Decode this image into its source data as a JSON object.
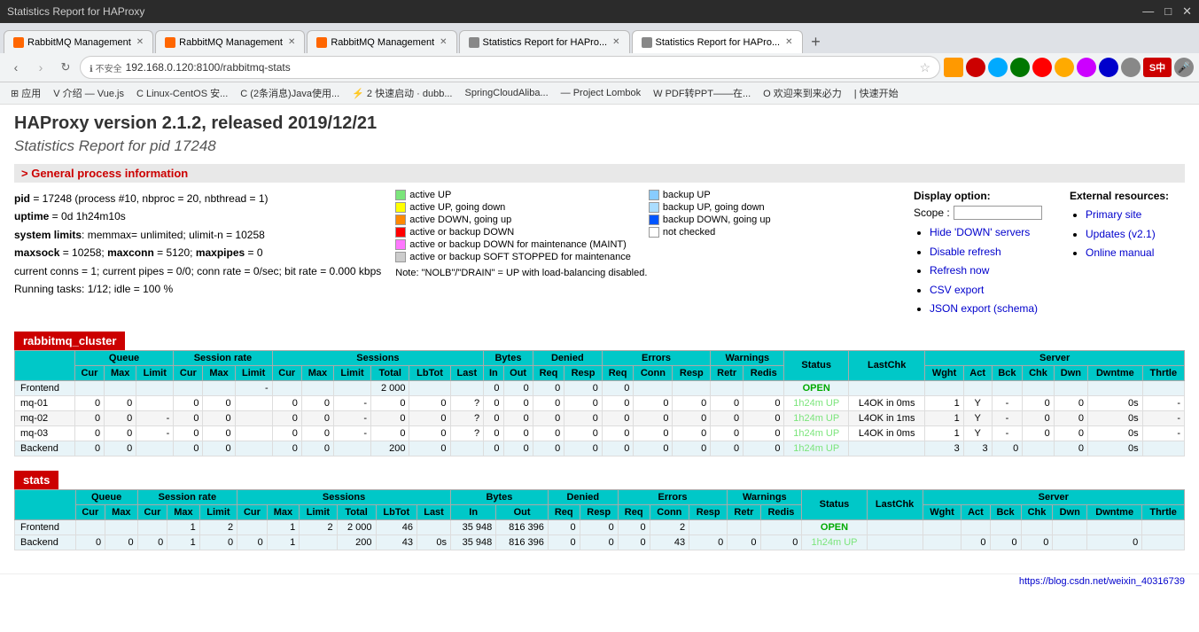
{
  "browser": {
    "tabs": [
      {
        "label": "RabbitMQ Management",
        "active": false,
        "favicon": "rabbit"
      },
      {
        "label": "RabbitMQ Management",
        "active": false,
        "favicon": "rabbit"
      },
      {
        "label": "RabbitMQ Management",
        "active": false,
        "favicon": "rabbit"
      },
      {
        "label": "Statistics Report for HAPro...",
        "active": false,
        "favicon": "stats"
      },
      {
        "label": "Statistics Report for HAPro...",
        "active": true,
        "favicon": "stats"
      }
    ],
    "address": "192.168.0.120:8100/rabbitmq-stats",
    "bookmarks": [
      "应用",
      "介绍 — Vue.js",
      "Linux-CentOS 安...",
      "(2条消息)Java使用...",
      "2 快速启动 · dubb...",
      "SpringCloudAliba...",
      "Project Lombok",
      "PDF转PPT——在...",
      "欢迎来到来必力",
      "快速开始"
    ],
    "title_bar_controls": [
      "—",
      "□",
      "×"
    ]
  },
  "page": {
    "version_title": "HAProxy version 2.1.2, released 2019/12/21",
    "stats_title": "Statistics Report for pid 17248",
    "section_general": "> General process information",
    "process_info": [
      "pid = 17248 (process #10, nbproc = 20, nbthread = 1)",
      "uptime = 0d 1h24m10s",
      "system limits: memmax= unlimited; ulimit-n = 10258",
      "maxsock = 10258; maxconn = 5120; maxpipes = 0",
      "current conns = 1; current pipes = 0/0; conn rate = 0/sec; bit rate = 0.000 kbps",
      "Running tasks: 1/12; idle = 100 %"
    ]
  },
  "legend": {
    "items_left": [
      {
        "color": "#00ff00",
        "label": "active UP"
      },
      {
        "color": "#ffff00",
        "label": "active UP, going down"
      },
      {
        "color": "#ff8800",
        "label": "active DOWN, going up"
      },
      {
        "color": "#ff0000",
        "label": "active or backup DOWN"
      },
      {
        "color": "#ff00ff",
        "label": "active or backup DOWN for maintenance (MAINT)"
      },
      {
        "color": "#aaaaaa",
        "label": "active or backup SOFT STOPPED for maintenance"
      }
    ],
    "items_right": [
      {
        "color": "#00aaff",
        "label": "backup UP"
      },
      {
        "color": "#88ccff",
        "label": "backup UP, going down"
      },
      {
        "color": "#0055ff",
        "label": "backup DOWN, going up"
      },
      {
        "color": "#ffffff",
        "label": "not checked"
      }
    ],
    "note": "Note: \"NOLB\"/\"DRAIN\" = UP with load-balancing disabled."
  },
  "display_options": {
    "title": "Display option:",
    "scope_label": "Scope :",
    "scope_value": "",
    "links": [
      {
        "label": "Hide 'DOWN' servers",
        "href": "#"
      },
      {
        "label": "Disable refresh",
        "href": "#"
      },
      {
        "label": "Refresh now",
        "href": "#"
      },
      {
        "label": "CSV export",
        "href": "#"
      },
      {
        "label": "JSON export",
        "href": "#"
      },
      {
        "label": "(schema)",
        "href": "#"
      }
    ]
  },
  "external_resources": {
    "title": "External resources:",
    "links": [
      {
        "label": "Primary site",
        "href": "#"
      },
      {
        "label": "Updates (v2.1)",
        "href": "#"
      },
      {
        "label": "Online manual",
        "href": "#"
      }
    ]
  },
  "sections": [
    {
      "name": "rabbitmq_cluster",
      "color": "#c00",
      "headers": {
        "queue": [
          "Cur",
          "Max",
          "Limit"
        ],
        "session_rate": [
          "Cur",
          "Max",
          "Limit"
        ],
        "sessions": [
          "Cur",
          "Max",
          "Limit",
          "Total",
          "LbTot",
          "Last"
        ],
        "bytes": [
          "In",
          "Out"
        ],
        "denied": [
          "Req",
          "Resp"
        ],
        "errors": [
          "Req",
          "Conn",
          "Resp"
        ],
        "warnings": [
          "Retr",
          "Redis"
        ],
        "status": "Status",
        "lastchk": "LastChk",
        "server": [
          "Wght",
          "Act",
          "Bck",
          "Chk",
          "Dwn",
          "Dwntme",
          "Thrtle"
        ]
      },
      "rows": [
        {
          "name": "Frontend",
          "type": "frontend",
          "queue": [
            "",
            "",
            ""
          ],
          "session_rate": [
            "",
            "",
            "-"
          ],
          "sessions": [
            "",
            "",
            "",
            "2 000",
            "",
            ""
          ],
          "bytes": [
            "0",
            "0"
          ],
          "denied": [
            "0",
            "0"
          ],
          "errors": [
            "0",
            "",
            ""
          ],
          "warnings": [
            "",
            ""
          ],
          "status": "OPEN",
          "lastchk": "",
          "server": [
            "",
            "",
            "",
            "",
            "",
            "",
            ""
          ]
        },
        {
          "name": "mq-01",
          "type": "server",
          "queue": [
            "0",
            "0",
            ""
          ],
          "session_rate": [
            "0",
            "0",
            ""
          ],
          "sessions": [
            "0",
            "0",
            "-",
            "0",
            "0",
            "?"
          ],
          "bytes": [
            "0",
            "0"
          ],
          "denied": [
            "0",
            "0"
          ],
          "errors": [
            "0",
            "0",
            "0"
          ],
          "warnings": [
            "0",
            "0"
          ],
          "status": "1h24m UP",
          "lastchk": "L4OK in 0ms",
          "server": [
            "1",
            "Y",
            "-",
            "0",
            "0",
            "0s",
            "-"
          ]
        },
        {
          "name": "mq-02",
          "type": "server",
          "queue": [
            "0",
            "0",
            "-"
          ],
          "session_rate": [
            "0",
            "0",
            ""
          ],
          "sessions": [
            "0",
            "0",
            "-",
            "0",
            "0",
            "?"
          ],
          "bytes": [
            "0",
            "0"
          ],
          "denied": [
            "0",
            "0"
          ],
          "errors": [
            "0",
            "0",
            "0"
          ],
          "warnings": [
            "0",
            "0"
          ],
          "status": "1h24m UP",
          "lastchk": "L4OK in 1ms",
          "server": [
            "1",
            "Y",
            "-",
            "0",
            "0",
            "0s",
            "-"
          ]
        },
        {
          "name": "mq-03",
          "type": "server",
          "queue": [
            "0",
            "0",
            "-"
          ],
          "session_rate": [
            "0",
            "0",
            ""
          ],
          "sessions": [
            "0",
            "0",
            "-",
            "0",
            "0",
            "?"
          ],
          "bytes": [
            "0",
            "0"
          ],
          "denied": [
            "0",
            "0"
          ],
          "errors": [
            "0",
            "0",
            "0"
          ],
          "warnings": [
            "0",
            "0"
          ],
          "status": "1h24m UP",
          "lastchk": "L4OK in 0ms",
          "server": [
            "1",
            "Y",
            "-",
            "0",
            "0",
            "0s",
            "-"
          ]
        },
        {
          "name": "Backend",
          "type": "backend",
          "queue": [
            "0",
            "0",
            ""
          ],
          "session_rate": [
            "0",
            "0",
            ""
          ],
          "sessions": [
            "0",
            "0",
            "",
            "200",
            "0",
            ""
          ],
          "bytes": [
            "0",
            "0"
          ],
          "denied": [
            "0",
            "0"
          ],
          "errors": [
            "0",
            "0",
            "0"
          ],
          "warnings": [
            "0",
            "0"
          ],
          "status": "1h24m UP",
          "lastchk": "",
          "server": [
            "3",
            "3",
            "0",
            "",
            "0",
            "0s",
            ""
          ]
        }
      ]
    },
    {
      "name": "stats",
      "color": "#c00",
      "rows": [
        {
          "name": "Frontend",
          "type": "frontend",
          "queue": [
            "",
            ""
          ],
          "session_rate": [
            "",
            "1",
            "2"
          ],
          "sessions": [
            "",
            "1",
            "2",
            "2 000",
            "46",
            ""
          ],
          "bytes": [
            "35 948",
            "816 396"
          ],
          "denied": [
            "0",
            "0"
          ],
          "errors": [
            "0",
            "2",
            ""
          ],
          "warnings": [
            "",
            ""
          ],
          "status": "OPEN",
          "lastchk": "",
          "server": [
            "",
            "",
            "",
            "",
            "",
            "",
            ""
          ]
        },
        {
          "name": "Backend",
          "type": "backend",
          "queue": [
            "0",
            "0"
          ],
          "session_rate": [
            "0",
            "1",
            "0"
          ],
          "sessions": [
            "0",
            "1",
            "",
            "200",
            "43",
            "0s"
          ],
          "bytes": [
            "35 948",
            "816 396"
          ],
          "denied": [
            "0",
            "0"
          ],
          "errors": [
            "0",
            "43",
            "0"
          ],
          "warnings": [
            "0",
            "0"
          ],
          "status": "1h24m UP",
          "lastchk": "",
          "server": [
            "",
            "0",
            "0",
            "0",
            "",
            "0",
            ""
          ]
        }
      ]
    }
  ],
  "footer": {
    "link_text": "https://blog.csdn.net/weixin_40316739"
  }
}
